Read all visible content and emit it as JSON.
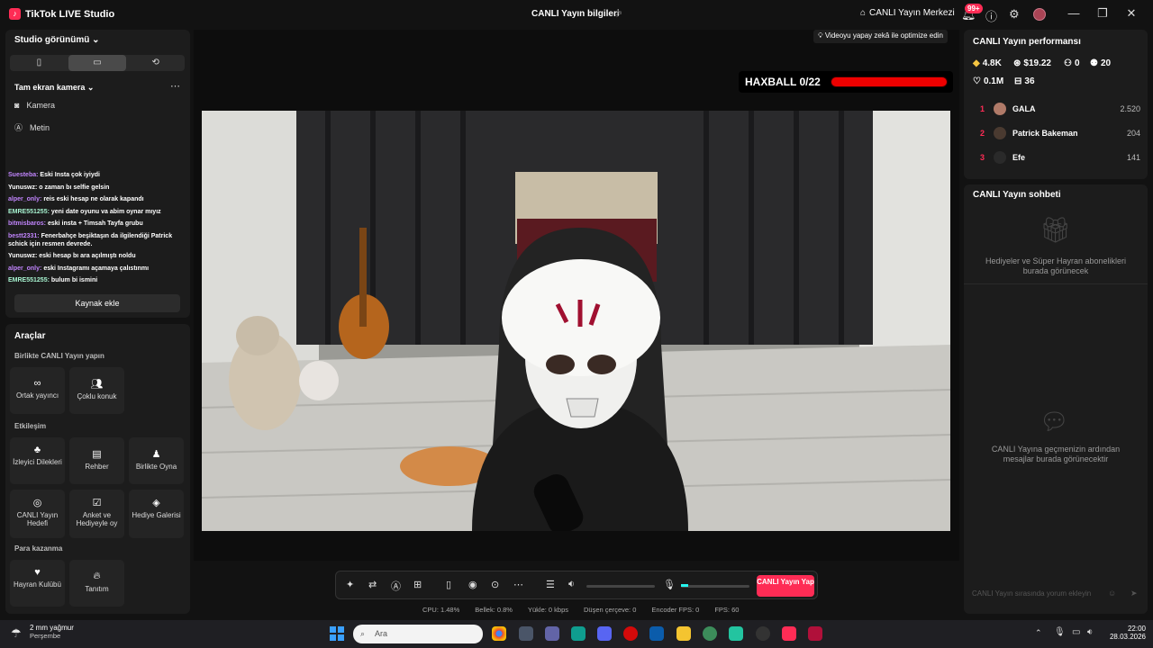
{
  "titlebar": {
    "app_title": "TikTok LIVE Studio",
    "live_info": "CANLI Yayın bilgileri",
    "center_link": "CANLI Yayın Merkezi",
    "notif_badge": "99+"
  },
  "studio": {
    "view_label": "Studio görünümü",
    "scene_name": "Tam ekran kamera",
    "sources": [
      "Kamera",
      "Metin"
    ],
    "add_source": "Kaynak ekle"
  },
  "chat_overlay": [
    {
      "user": "Suesteba:",
      "msg": "Eski Insta çok iyiydi",
      "color": "#c084fc"
    },
    {
      "user": "Yunuswz:",
      "msg": "o zaman bı selfie gelsin",
      "color": "#ffffff"
    },
    {
      "user": "alper_only:",
      "msg": "reis eski hesap ne olarak kapandı",
      "color": "#c084fc"
    },
    {
      "user": "EMRE551255:",
      "msg": "yeni date oyunu va abim oynar mıyız",
      "color": "#a7f3d0"
    },
    {
      "user": "bitmisbaros:",
      "msg": "eski insta + Timsah Tayfa grubu",
      "color": "#c084fc"
    },
    {
      "user": "bestt2331:",
      "msg": "Fenerbahçe beşiktaşın da ilgilendiği Patrick schick için resmen devrede.",
      "color": "#c084fc"
    },
    {
      "user": "Yunuswz:",
      "msg": "eski hesap bı ara açılmıştı noldu",
      "color": "#ffffff"
    },
    {
      "user": "alper_only:",
      "msg": "eski Instagramı açamaya çalıstınmı",
      "color": "#c084fc"
    },
    {
      "user": "EMRE551255:",
      "msg": "bulum bi ismini",
      "color": "#a7f3d0"
    }
  ],
  "tools": {
    "title": "Araçlar",
    "section_collab": "Birlikte CANLI Yayın yapın",
    "collab": [
      "Ortak yayıncı",
      "Çoklu konuk"
    ],
    "section_interaction": "Etkileşim",
    "interaction": [
      "İzleyici Dilekleri",
      "Rehber",
      "Birlikte Oyna",
      "CANLI Yayın Hedefi",
      "Anket ve Hediyeyle oy",
      "Hediye Galerisi"
    ],
    "section_earn": "Para kazanma",
    "earn": [
      "Hayran Kulübü",
      "Tanıtım"
    ]
  },
  "preview": {
    "optimize_tip": "Videoyu yapay zekâ ile optimize edin",
    "haxball": "HAXBALL 0/22",
    "go_live": "CANLI Yayın Yap"
  },
  "stats": {
    "cpu": "CPU:  1.48%",
    "memory": "Bellek:  0.8%",
    "upload": "Yükle:  0 kbps",
    "dropped": "Düşen çerçeve:  0",
    "encoder": "Encoder FPS:  0",
    "fps": "FPS:  60"
  },
  "performance": {
    "title": "CANLI Yayın performansı",
    "diamonds": "4.8K",
    "earnings": "$19.22",
    "viewers": "0",
    "new_followers": "20",
    "likes": "0.1M",
    "gifts": "36",
    "ranking": [
      {
        "rank": "1",
        "name": "GALA",
        "value": "2.520"
      },
      {
        "rank": "2",
        "name": "Patrick Bakeman",
        "value": "204"
      },
      {
        "rank": "3",
        "name": "Efe",
        "value": "141"
      }
    ]
  },
  "chat": {
    "title": "CANLI Yayın sohbeti",
    "gifts_placeholder": "Hediyeler ve Süper Hayran abonelikleri burada görünecek",
    "messages_placeholder": "CANLI Yayına geçmenizin ardından mesajlar burada görünecektir",
    "input_placeholder": "CANLI Yayın sırasında yorum ekleyin"
  },
  "taskbar": {
    "weather_temp": "2 mm yağmur",
    "weather_day": "Perşembe",
    "search": "Ara",
    "time": "22:00",
    "date": "28.03.2026"
  },
  "colors": {
    "accent": "#fe2c55",
    "panel": "#1c1c1c",
    "background": "#121212"
  }
}
